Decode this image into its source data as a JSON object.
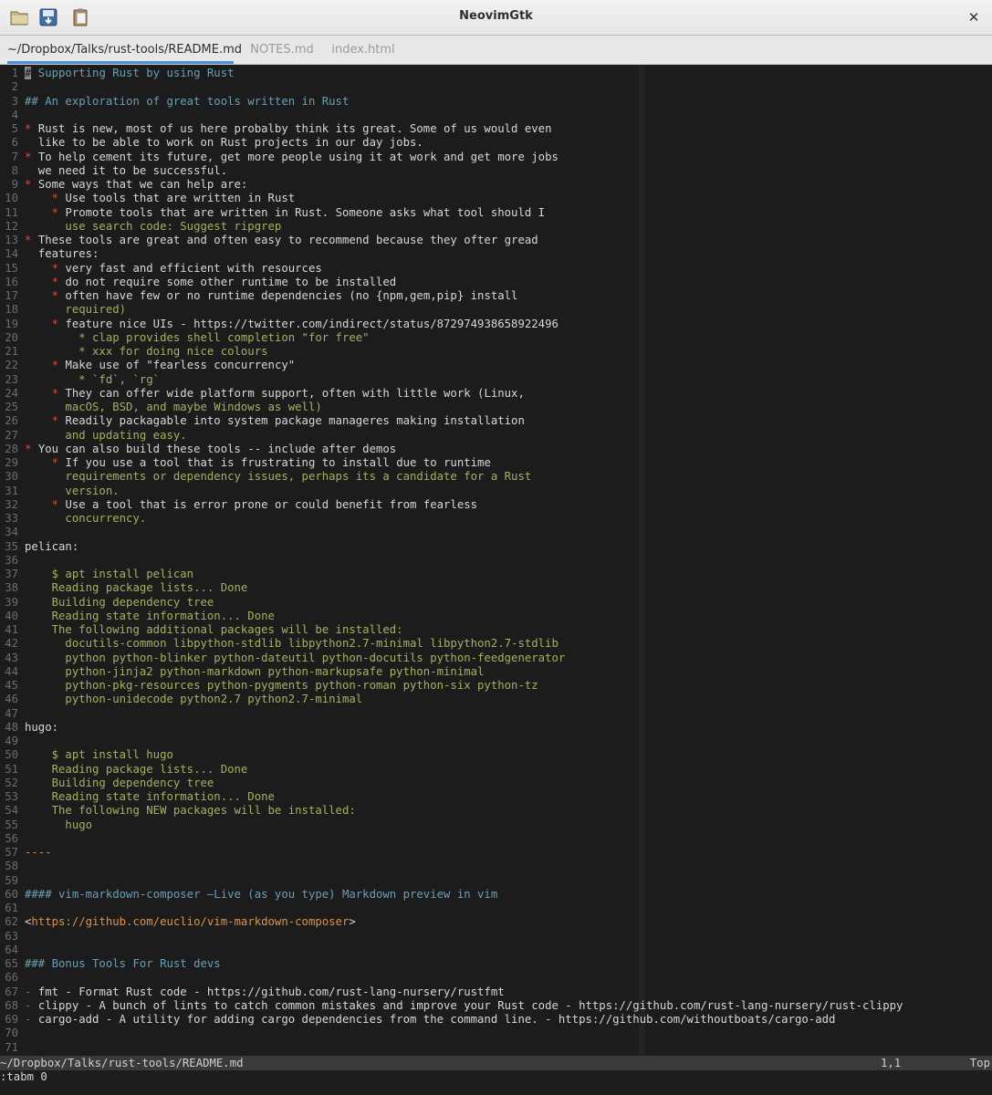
{
  "window": {
    "title": "NeovimGtk",
    "close": "✕"
  },
  "tabs": [
    {
      "label": "~/Dropbox/Talks/rust-tools/README.md",
      "active": true
    },
    {
      "label": "NOTES.md",
      "active": false
    },
    {
      "label": "index.html",
      "active": false
    }
  ],
  "colors": {
    "background": "#1c1c1c",
    "heading": "#6a9fb5",
    "bullet": "#d84a45",
    "text": "#d7d7d7",
    "code": "#a7b05e",
    "url": "#d8944a",
    "tab_accent": "#4a90d9"
  },
  "lines": [
    [
      [
        "head",
        "# Supporting Rust by using Rust"
      ]
    ],
    [],
    [
      [
        "head",
        "## An exploration of great tools written in Rust"
      ]
    ],
    [],
    [
      [
        "bullet",
        "* "
      ],
      [
        "text",
        "Rust is new, most of us here probalby think its great. Some of us would even"
      ]
    ],
    [
      [
        "text",
        "  like to be able to work on Rust projects in our day jobs."
      ]
    ],
    [
      [
        "bullet",
        "* "
      ],
      [
        "text",
        "To help cement its future, get more people using it at work and get more jobs"
      ]
    ],
    [
      [
        "text",
        "  we need it to be successful."
      ]
    ],
    [
      [
        "bullet",
        "* "
      ],
      [
        "text",
        "Some ways that we can help are:"
      ]
    ],
    [
      [
        "text",
        "    "
      ],
      [
        "bullet",
        "* "
      ],
      [
        "text",
        "Use tools that are written in Rust"
      ]
    ],
    [
      [
        "text",
        "    "
      ],
      [
        "bullet",
        "* "
      ],
      [
        "text",
        "Promote tools that are written in Rust. Someone asks what tool should I"
      ]
    ],
    [
      [
        "code",
        "      use search code: Suggest ripgrep"
      ]
    ],
    [
      [
        "bullet",
        "* "
      ],
      [
        "text",
        "These tools are great and often easy to recommend because they ofter gread"
      ]
    ],
    [
      [
        "text",
        "  features:"
      ]
    ],
    [
      [
        "text",
        "    "
      ],
      [
        "bullet",
        "* "
      ],
      [
        "text",
        "very fast and efficient with resources"
      ]
    ],
    [
      [
        "text",
        "    "
      ],
      [
        "bullet",
        "* "
      ],
      [
        "text",
        "do not require some other runtime to be installed"
      ]
    ],
    [
      [
        "text",
        "    "
      ],
      [
        "bullet",
        "* "
      ],
      [
        "text",
        "often have few or no runtime dependencies (no {npm,gem,pip} install"
      ]
    ],
    [
      [
        "code",
        "      required)"
      ]
    ],
    [
      [
        "text",
        "    "
      ],
      [
        "bullet",
        "* "
      ],
      [
        "text",
        "feature nice UIs - https://twitter.com/indirect/status/872974938658922496"
      ]
    ],
    [
      [
        "code",
        "        * clap provides shell completion \"for free\""
      ]
    ],
    [
      [
        "code",
        "        * xxx for doing nice colours"
      ]
    ],
    [
      [
        "text",
        "    "
      ],
      [
        "bullet",
        "* "
      ],
      [
        "text",
        "Make use of \"fearless concurrency\""
      ]
    ],
    [
      [
        "code",
        "        * `fd`, `rg`"
      ]
    ],
    [
      [
        "text",
        "    "
      ],
      [
        "bullet",
        "* "
      ],
      [
        "text",
        "They can offer wide platform support, often with little work (Linux,"
      ]
    ],
    [
      [
        "code",
        "      macOS, BSD, and maybe Windows as well)"
      ]
    ],
    [
      [
        "text",
        "    "
      ],
      [
        "bullet",
        "* "
      ],
      [
        "text",
        "Readily packagable into system package manageres making installation"
      ]
    ],
    [
      [
        "code",
        "      and updating easy."
      ]
    ],
    [
      [
        "bullet",
        "* "
      ],
      [
        "text",
        "You can also build these tools -- include after demos"
      ]
    ],
    [
      [
        "text",
        "    "
      ],
      [
        "bullet",
        "* "
      ],
      [
        "text",
        "If you use a tool that is frustrating to install due to runtime"
      ]
    ],
    [
      [
        "code",
        "      requirements or dependency issues, perhaps its a candidate for a Rust"
      ]
    ],
    [
      [
        "code",
        "      version."
      ]
    ],
    [
      [
        "text",
        "    "
      ],
      [
        "bullet",
        "* "
      ],
      [
        "text",
        "Use a tool that is error prone or could benefit from fearless"
      ]
    ],
    [
      [
        "code",
        "      concurrency."
      ]
    ],
    [],
    [
      [
        "text",
        "pelican:"
      ]
    ],
    [],
    [
      [
        "code",
        "    $ apt install pelican"
      ]
    ],
    [
      [
        "code",
        "    Reading package lists... Done"
      ]
    ],
    [
      [
        "code",
        "    Building dependency tree"
      ]
    ],
    [
      [
        "code",
        "    Reading state information... Done"
      ]
    ],
    [
      [
        "code",
        "    The following additional packages will be installed:"
      ]
    ],
    [
      [
        "code",
        "      docutils-common libpython-stdlib libpython2.7-minimal libpython2.7-stdlib"
      ]
    ],
    [
      [
        "code",
        "      python python-blinker python-dateutil python-docutils python-feedgenerator"
      ]
    ],
    [
      [
        "code",
        "      python-jinja2 python-markdown python-markupsafe python-minimal"
      ]
    ],
    [
      [
        "code",
        "      python-pkg-resources python-pygments python-roman python-six python-tz"
      ]
    ],
    [
      [
        "code",
        "      python-unidecode python2.7 python2.7-minimal"
      ]
    ],
    [],
    [
      [
        "text",
        "hugo:"
      ]
    ],
    [],
    [
      [
        "code",
        "    $ apt install hugo"
      ]
    ],
    [
      [
        "code",
        "    Reading package lists... Done"
      ]
    ],
    [
      [
        "code",
        "    Building dependency tree"
      ]
    ],
    [
      [
        "code",
        "    Reading state information... Done"
      ]
    ],
    [
      [
        "code",
        "    The following NEW packages will be installed:"
      ]
    ],
    [
      [
        "code",
        "      hugo"
      ]
    ],
    [],
    [
      [
        "rule",
        "----"
      ]
    ],
    [],
    [],
    [
      [
        "head",
        "#### vim-markdown-composer —Live (as you type) Markdown preview in vim"
      ]
    ],
    [],
    [
      [
        "text",
        "<"
      ],
      [
        "url",
        "https://github.com/euclio/vim-markdown-composer"
      ],
      [
        "text",
        ">"
      ]
    ],
    [],
    [],
    [
      [
        "head",
        "### Bonus Tools For Rust devs"
      ]
    ],
    [],
    [
      [
        "bullet",
        "- "
      ],
      [
        "text",
        "fmt - Format Rust code - https://github.com/rust-lang-nursery/rustfmt"
      ]
    ],
    [
      [
        "bullet",
        "- "
      ],
      [
        "text",
        "clippy - A bunch of lints to catch common mistakes and improve your Rust code - https://github.com/rust-lang-nursery/rust-clippy"
      ]
    ],
    [
      [
        "bullet",
        "- "
      ],
      [
        "text",
        "cargo-add - A utility for adding cargo dependencies from the command line. - https://github.com/withoutboats/cargo-add"
      ]
    ],
    [],
    []
  ],
  "status": {
    "file": "~/Dropbox/Talks/rust-tools/README.md",
    "position": "1,1",
    "scroll": "Top"
  },
  "cmdline": ":tabm 0"
}
